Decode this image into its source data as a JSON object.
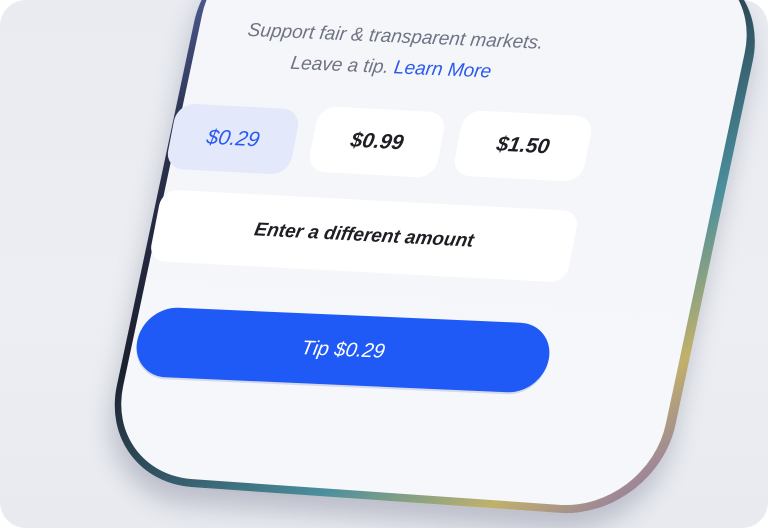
{
  "header": {
    "subtitle_line1": "Support fair & transparent markets.",
    "subtitle_line2_prefix": "Leave a tip.",
    "learn_more_label": "Learn More"
  },
  "tip_options": [
    {
      "label": "$0.29",
      "selected": true
    },
    {
      "label": "$0.99",
      "selected": false
    },
    {
      "label": "$1.50",
      "selected": false
    }
  ],
  "custom_amount_label": "Enter a different amount",
  "submit_label": "Tip $0.29",
  "colors": {
    "accent": "#1f5af6",
    "selected_chip_bg": "#e3e8fa",
    "link": "#2a59f0"
  }
}
